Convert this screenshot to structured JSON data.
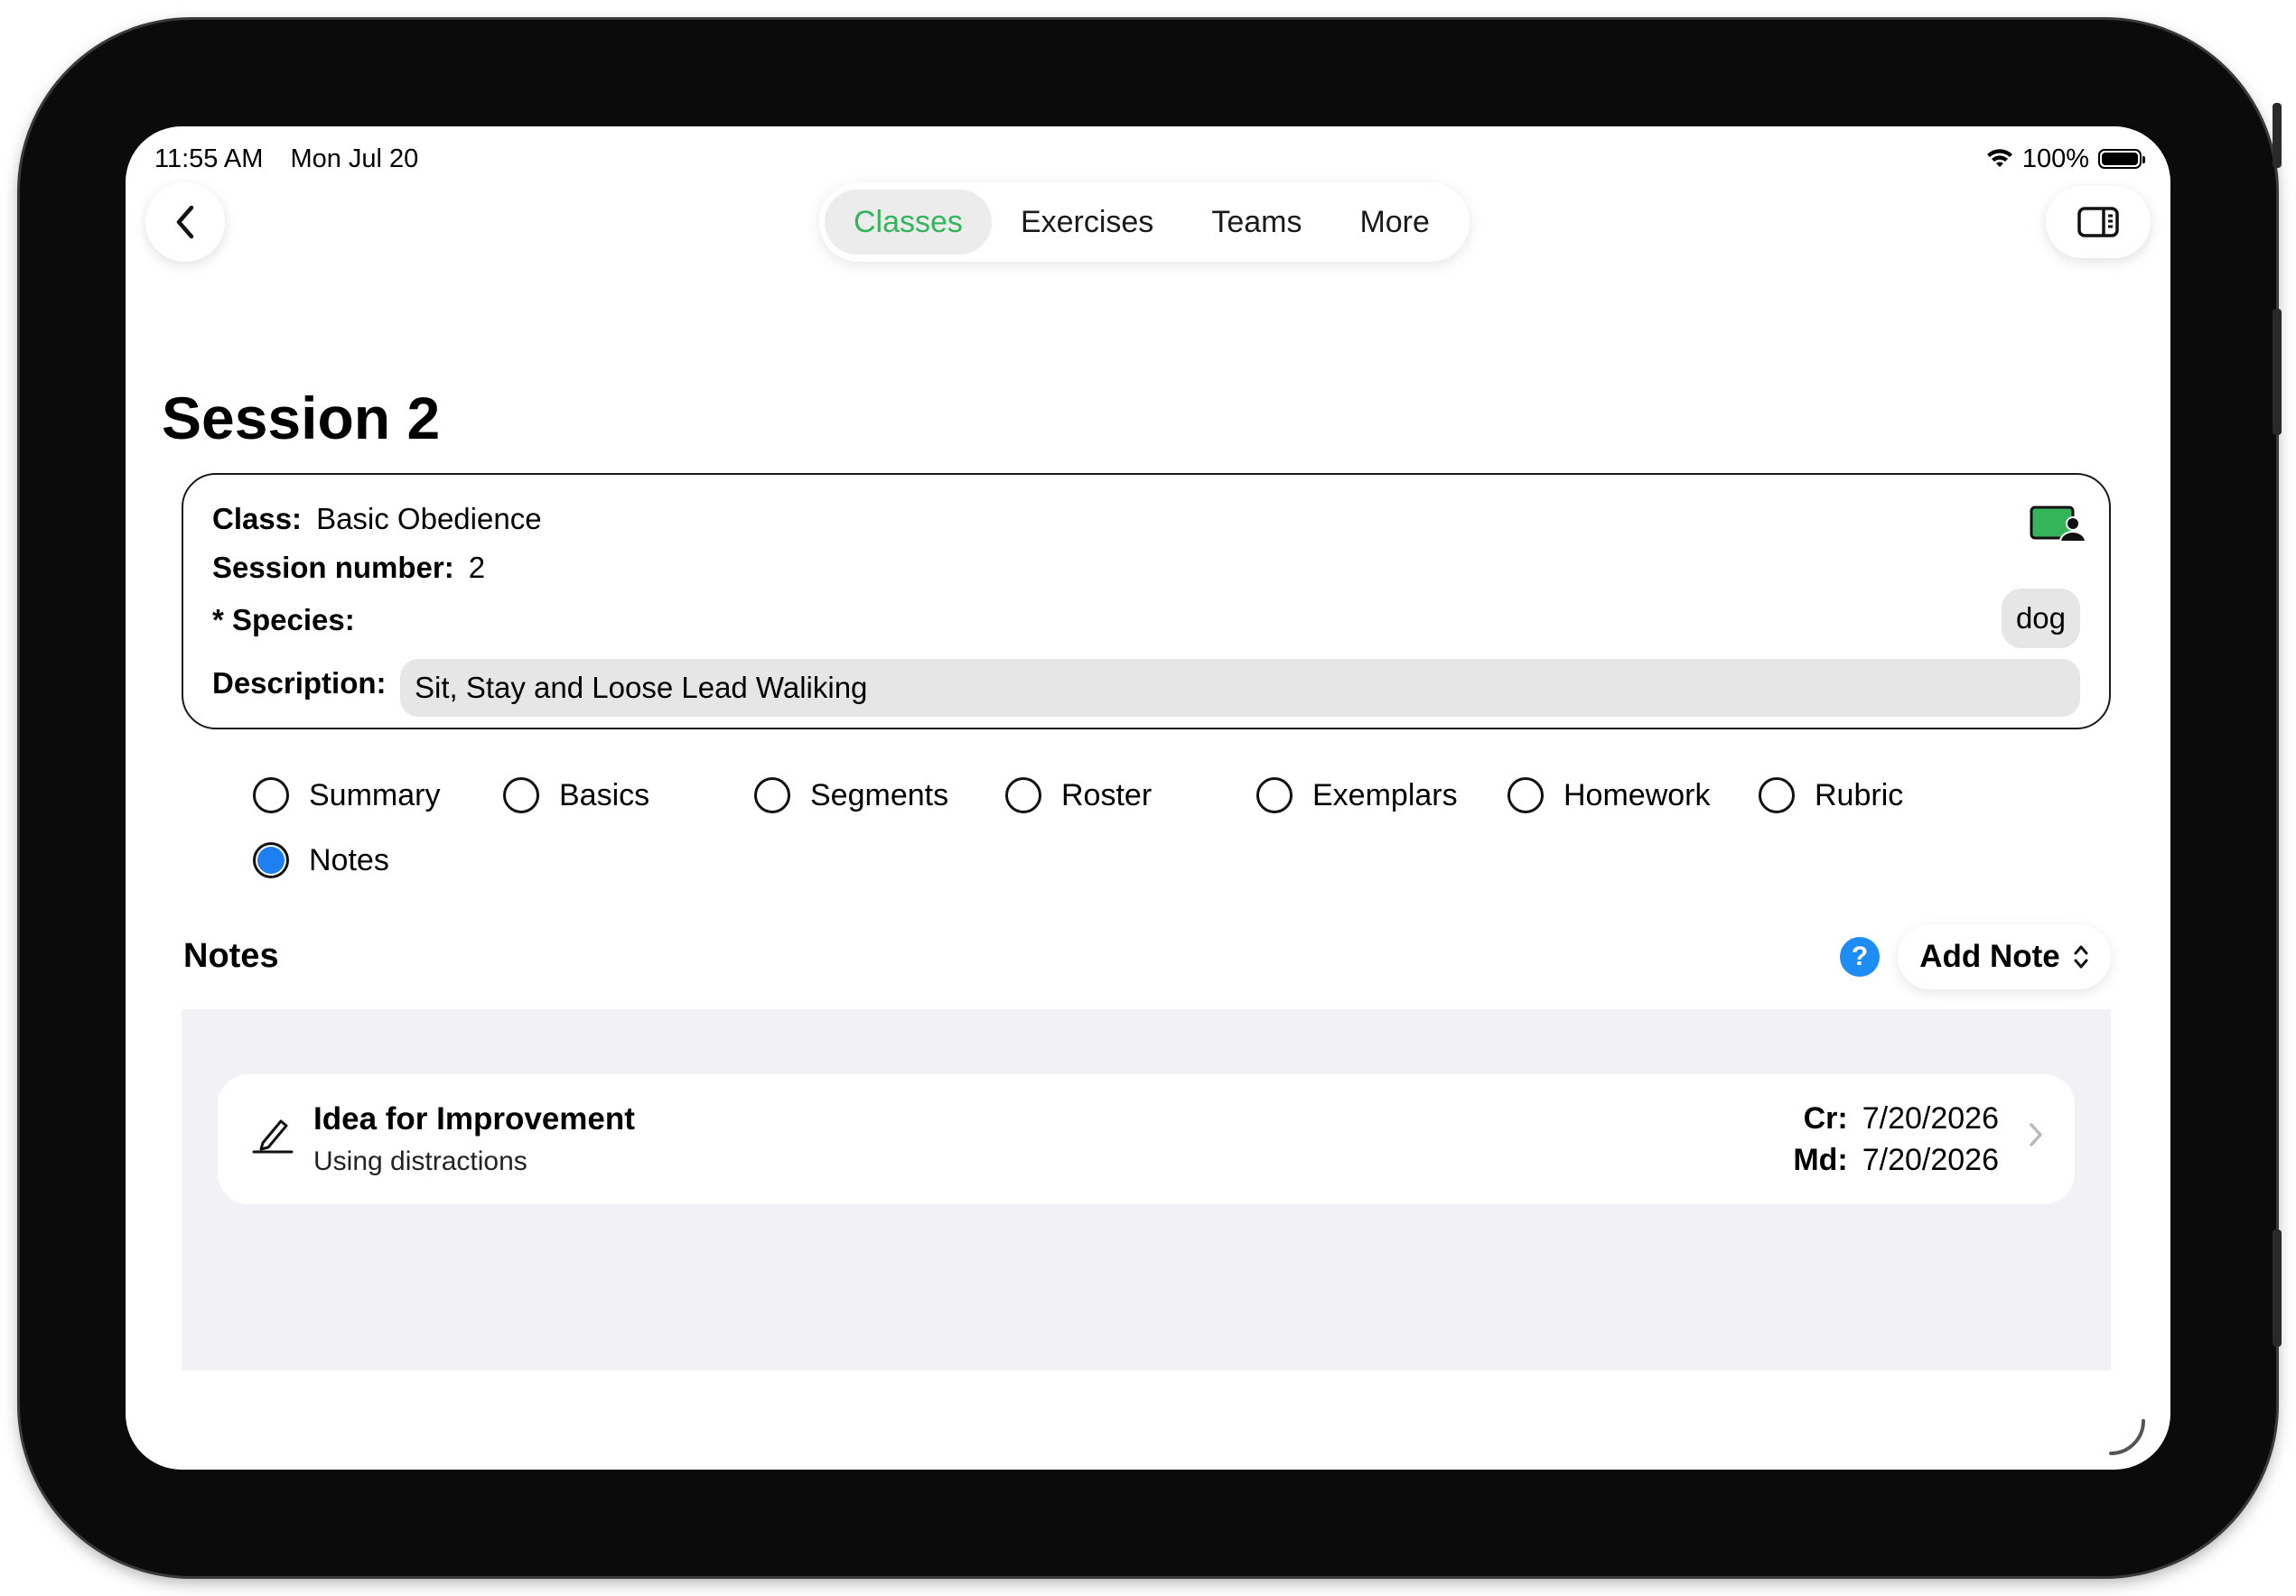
{
  "status": {
    "time": "11:55 AM",
    "date": "Mon Jul 20",
    "battery": "100%",
    "battery_level": 1.0
  },
  "nav": {
    "tabs": [
      {
        "label": "Classes",
        "active": true
      },
      {
        "label": "Exercises",
        "active": false
      },
      {
        "label": "Teams",
        "active": false
      },
      {
        "label": "More",
        "active": false
      }
    ],
    "back_icon": "chevron-left-icon",
    "sidebar_icon": "sidebar-right-icon"
  },
  "page": {
    "title": "Session 2"
  },
  "info": {
    "class_label": "Class:",
    "class_value": "Basic Obedience",
    "session_label": "Session number:",
    "session_value": "2",
    "species_label": "* Species:",
    "species_value": "dog",
    "description_label": "Description:",
    "description_value": "Sit, Stay and Loose Lead Waliking",
    "badge_icon": "class-person-icon",
    "accent": "#34b55a"
  },
  "sections": [
    {
      "label": "Summary",
      "selected": false
    },
    {
      "label": "Basics",
      "selected": false
    },
    {
      "label": "Segments",
      "selected": false
    },
    {
      "label": "Roster",
      "selected": false
    },
    {
      "label": "Exemplars",
      "selected": false
    },
    {
      "label": "Homework",
      "selected": false
    },
    {
      "label": "Rubric",
      "selected": false
    },
    {
      "label": "Notes",
      "selected": true
    }
  ],
  "notes": {
    "title": "Notes",
    "help_label": "?",
    "add_label": "Add Note",
    "items": [
      {
        "title": "Idea for Improvement",
        "subtitle": "Using distractions",
        "created_label": "Cr:",
        "created": "7/20/2026",
        "modified_label": "Md:",
        "modified": "7/20/2026",
        "icon": "pencil-line-icon"
      }
    ]
  },
  "colors": {
    "selected_radio": "#1e7ff0",
    "help": "#1e8cf5",
    "panel_bg": "#f2f2f6"
  }
}
